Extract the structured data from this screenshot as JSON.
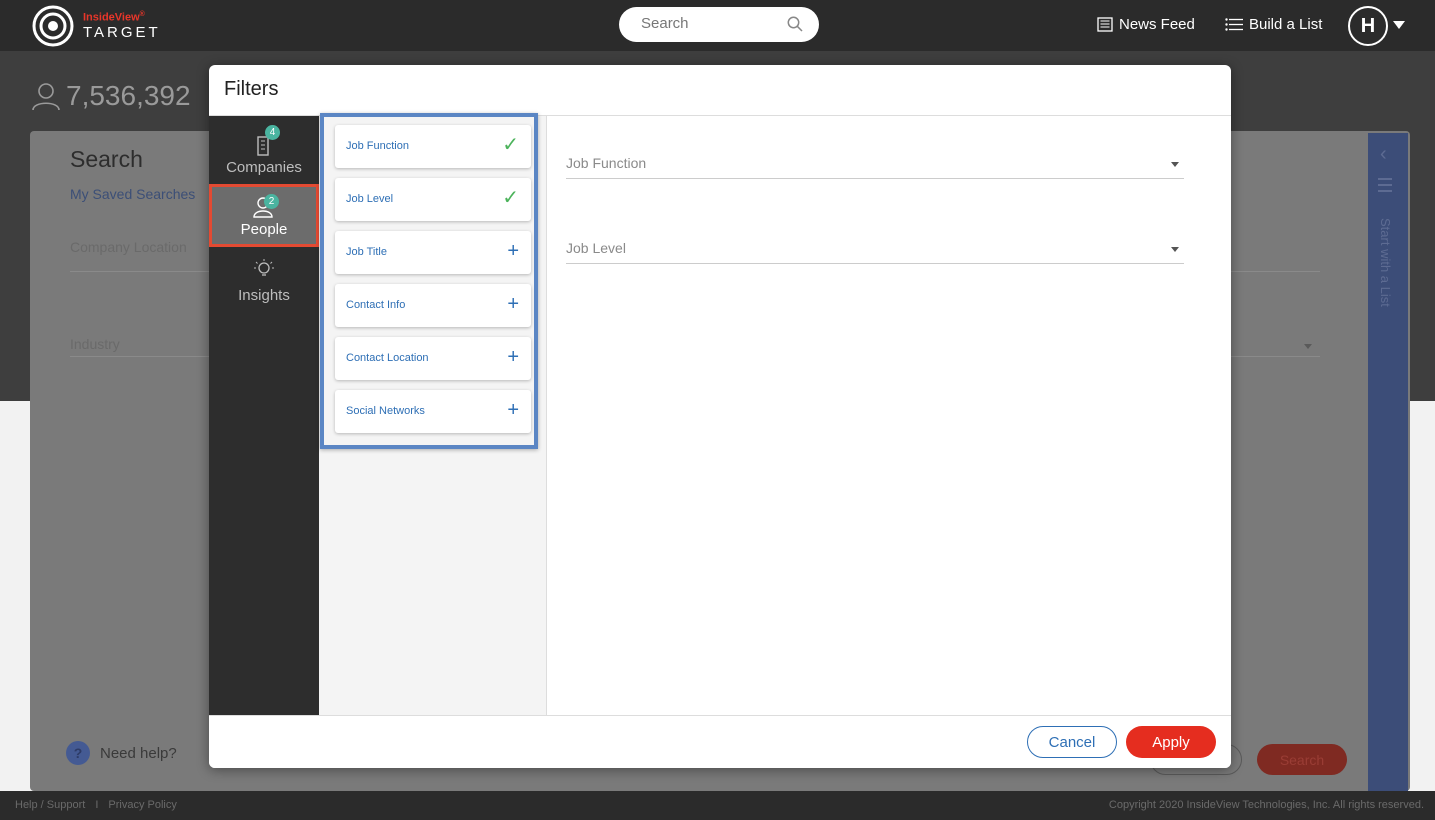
{
  "app": {
    "brand_name": "InsideView",
    "brand_reg": "®",
    "brand_product": "TARGET"
  },
  "header": {
    "search_placeholder": "Search",
    "news_feed": "News Feed",
    "build_list": "Build a List",
    "avatar_initial": "H"
  },
  "background": {
    "count": "7,536,392",
    "search_title": "Search",
    "saved_searches": "My Saved Searches",
    "company_location": "Company Location",
    "industry": "Industry",
    "need_help": "Need help?",
    "help_q": "?",
    "search_button": "Search",
    "side_panel_label": "Start with a List",
    "footer_help": "Help / Support",
    "footer_sep": "I",
    "footer_privacy": "Privacy Policy",
    "copyright": "Copyright 2020 InsideView Technologies, Inc. All rights reserved."
  },
  "modal": {
    "title": "Filters",
    "categories": [
      {
        "label": "Companies",
        "badge": "4"
      },
      {
        "label": "People",
        "badge": "2"
      },
      {
        "label": "Insights",
        "badge": ""
      }
    ],
    "subfilters": [
      {
        "label": "Job Function",
        "state": "selected",
        "icon": "✓"
      },
      {
        "label": "Job Level",
        "state": "selected",
        "icon": "✓"
      },
      {
        "label": "Job Title",
        "state": "add",
        "icon": "+"
      },
      {
        "label": "Contact Info",
        "state": "add",
        "icon": "+"
      },
      {
        "label": "Contact Location",
        "state": "add",
        "icon": "+"
      },
      {
        "label": "Social Networks",
        "state": "add",
        "icon": "+"
      }
    ],
    "fields": {
      "job_function": "Job Function",
      "job_level": "Job Level"
    },
    "cancel": "Cancel",
    "apply": "Apply"
  },
  "colors": {
    "brand_red": "#e52d1f",
    "link_blue": "#2e6fb5",
    "check_green": "#4cb35b",
    "highlight_blue": "#5b86c4",
    "highlight_red": "#e34a32",
    "badge_teal": "#4ab4a0"
  }
}
